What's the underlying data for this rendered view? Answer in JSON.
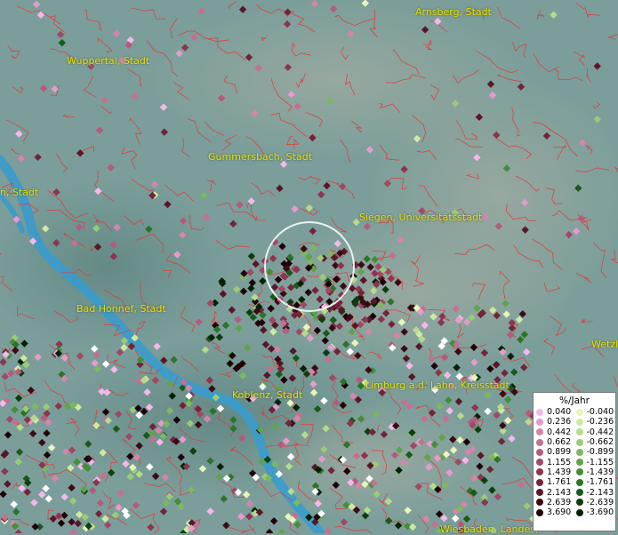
{
  "cities": [
    {
      "id": "arnsberg",
      "label": "Arnsberg, Stadt"
    },
    {
      "id": "wuppertal",
      "label": "Wuppertal, Stadt"
    },
    {
      "id": "gummersbach",
      "label": "Gummersbach, Stadt"
    },
    {
      "id": "koeln",
      "label": "n, Stadt"
    },
    {
      "id": "siegen",
      "label": "Siegen, Universitätsstadt"
    },
    {
      "id": "bad-honnef",
      "label": "Bad Honnef, Stadt"
    },
    {
      "id": "koblenz",
      "label": "Koblenz, Stadt"
    },
    {
      "id": "limburg",
      "label": "Limburg a.d. Lahn, Kreisstadt"
    },
    {
      "id": "wetzlar",
      "label": "Wetzla"
    },
    {
      "id": "wiesbaden",
      "label": "Wiesbaden, Landesh"
    }
  ],
  "legend": {
    "title": "%/Jahr",
    "positive": [
      {
        "label": "0.040",
        "color": "#f4b8ec"
      },
      {
        "label": "0.236",
        "color": "#e59bcb"
      },
      {
        "label": "0.442",
        "color": "#d585ab"
      },
      {
        "label": "0.662",
        "color": "#c56f92"
      },
      {
        "label": "0.899",
        "color": "#b55a7d"
      },
      {
        "label": "1.155",
        "color": "#a24766"
      },
      {
        "label": "1.439",
        "color": "#8c3450"
      },
      {
        "label": "1.761",
        "color": "#73243a"
      },
      {
        "label": "2.143",
        "color": "#5a1628"
      },
      {
        "label": "2.639",
        "color": "#3c0a16"
      },
      {
        "label": "3.690",
        "color": "#200008"
      }
    ],
    "negative": [
      {
        "label": "-0.040",
        "color": "#e8f5b8"
      },
      {
        "label": "-0.236",
        "color": "#cfeaa0"
      },
      {
        "label": "-0.442",
        "color": "#b5dc8a"
      },
      {
        "label": "-0.662",
        "color": "#99cc74"
      },
      {
        "label": "-0.899",
        "color": "#7cb95e"
      },
      {
        "label": "-1.155",
        "color": "#5fa44a"
      },
      {
        "label": "-1.439",
        "color": "#438e37"
      },
      {
        "label": "-1.761",
        "color": "#2c7426"
      },
      {
        "label": "-2.143",
        "color": "#1a5a18"
      },
      {
        "label": "-2.639",
        "color": "#0c3f0c"
      },
      {
        "label": "-3.690",
        "color": "#032203"
      }
    ]
  }
}
